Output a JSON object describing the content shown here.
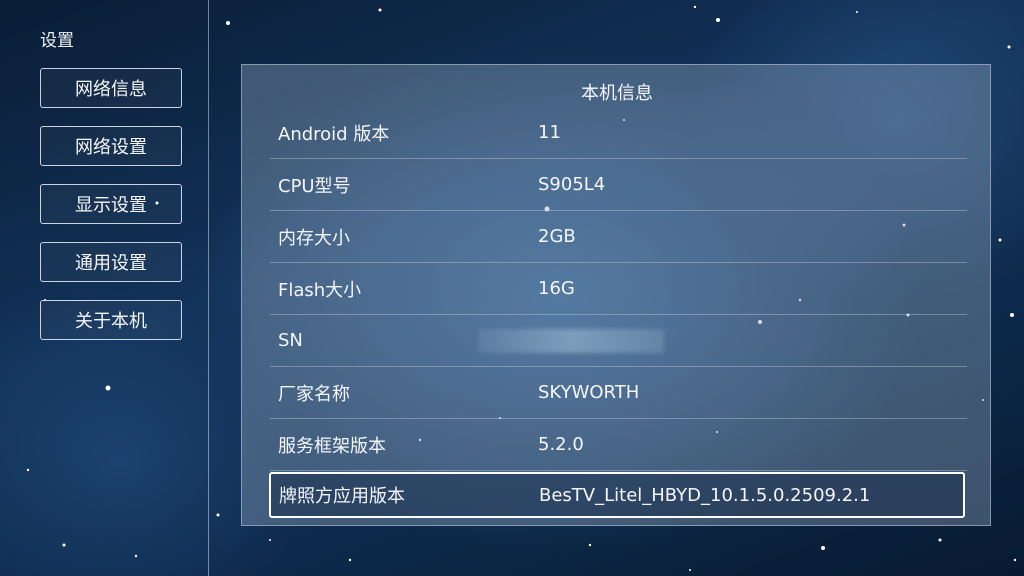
{
  "sidebar": {
    "title": "设置",
    "items": [
      {
        "label": "网络信息"
      },
      {
        "label": "网络设置"
      },
      {
        "label": "显示设置"
      },
      {
        "label": "通用设置"
      },
      {
        "label": "关于本机"
      }
    ]
  },
  "panel": {
    "title": "本机信息",
    "rows": [
      {
        "label": "Android 版本",
        "value": "11"
      },
      {
        "label": "CPU型号",
        "value": "S905L4"
      },
      {
        "label": "内存大小",
        "value": "2GB"
      },
      {
        "label": "Flash大小",
        "value": "16G"
      },
      {
        "label": "SN",
        "value": ""
      },
      {
        "label": "厂家名称",
        "value": "SKYWORTH"
      },
      {
        "label": "服务框架版本",
        "value": "5.2.0"
      },
      {
        "label": "牌照方应用版本",
        "value": "BesTV_Litel_HBYD_10.1.5.0.2509.2.1"
      }
    ],
    "selected_row": 7
  }
}
